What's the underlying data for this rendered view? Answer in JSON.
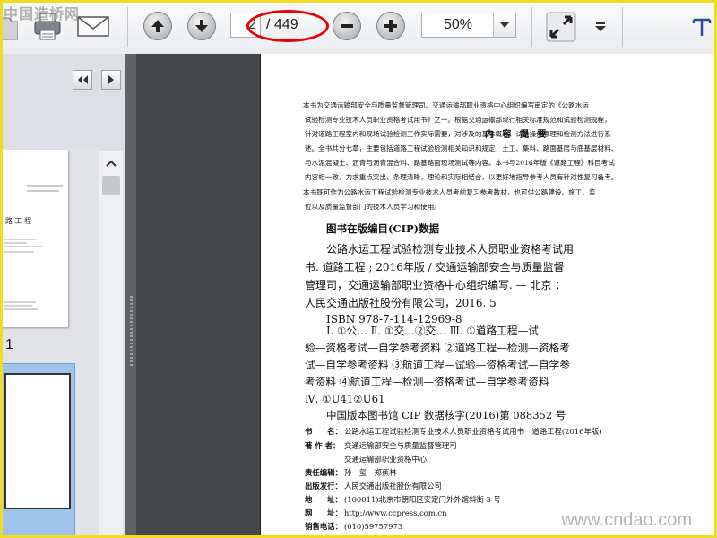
{
  "watermark_top": "中国造桥网",
  "watermark_bottom": "www.cndao.com",
  "toolbar": {
    "current_page": "2",
    "total_pages": "/ 449",
    "zoom": "50%"
  },
  "sidebar": {
    "page_label": "1"
  },
  "thumb1_lines": [
    "路 工 程"
  ],
  "document": {
    "heading": "内 容 提 要",
    "summary_lines": [
      "本书为交通运输部安全与质量监督管理司、交通运输部职业资格中心组织编写审定的《公路水运",
      "试验检测专业技术人员职业资格考试用书》之一。根据交通运输部现行相关标准规范和试验检测规程，",
      "针对道路工程室内和现场试验检测工作实际需要，对涉及的基本概念、试验操作原理和检测方法进行系",
      "述。全书共分七章，主要包括道路工程试验检测相关知识和规定，土工、集料、路面基层与底基层材料、",
      "与水泥混凝土、沥青与沥青混合料、路基路面现场测试等内容。本书与2016年版《道路工程》科目考试",
      "内容相一致，力求重点突出、条理清晰，理论和实际相结合，以更好地指导参考人员有针对性复习备考。"
    ],
    "usage_lines": [
      "本书既可作为公路水运工程试验检测专业技术人员考前复习参考教材，也可供公路建设、施工、监",
      "位以及质量监督部门的技术人员学习和使用。"
    ],
    "cip_heading": "图书在版编目(CIP)数据",
    "cip_lines": [
      "公路水运工程试验检测专业技术人员职业资格考试用",
      "书. 道路工程 ; 2016年版 / 交通运输部安全与质量监督",
      "管理司，交通运输部职业资格中心组织编写. — 北京 ：",
      "人民交通出版社股份有限公司，2016. 5",
      "ISBN 978-7-114-12969-8"
    ],
    "classification_lines": [
      "Ⅰ. ①公…   Ⅱ. ①交…②交…   Ⅲ. ①道路工程—试",
      "验—资格考试—自学参考资料 ②道路工程—检测—资格考",
      "试—自学参考资料 ③航道工程—试验—资格考试—自学参",
      "考资料 ④航道工程—检测—资格考试—自学参考资料",
      "Ⅳ. ①U41②U61"
    ],
    "cip_number": "中国版本图书馆 CIP 数据核字(2016)第 088352 号",
    "meta": [
      {
        "label": "书　　名：",
        "value": "公路水运工程试验检测专业技术人员职业资格考试用书　道路工程(2016年版)"
      },
      {
        "label": "著 作 者：",
        "value": "交通运输部安全与质量监督管理司"
      },
      {
        "label": "",
        "value": "交通运输部职业资格中心"
      },
      {
        "label": "责任编辑：",
        "value": "孙　玺　郑蕉林"
      },
      {
        "label": "出版发行：",
        "value": "人民交通出版社股份有限公司"
      },
      {
        "label": "地　　址：",
        "value": "(100011)北京市朝阳区安定门外外馆斜街 3 号"
      },
      {
        "label": "网　　址：",
        "value": "http://www.ccpress.com.cn"
      },
      {
        "label": "销售电话：",
        "value": "(010)59757973"
      }
    ]
  }
}
